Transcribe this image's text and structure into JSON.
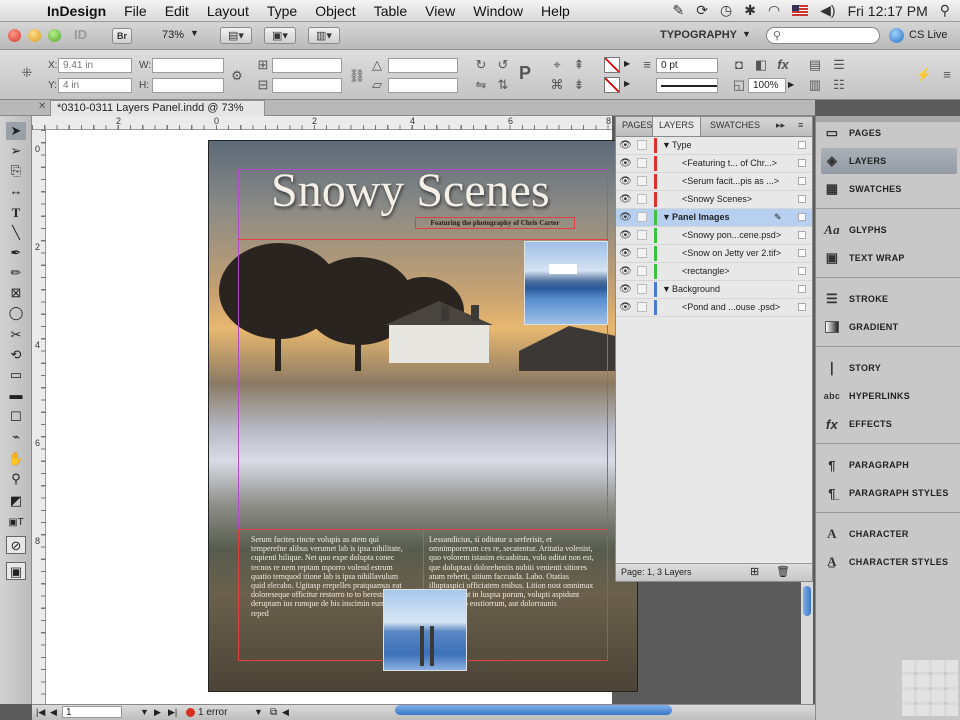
{
  "menubar": {
    "app": "InDesign",
    "items": [
      "File",
      "Edit",
      "Layout",
      "Type",
      "Object",
      "Table",
      "View",
      "Window",
      "Help"
    ],
    "clock": "Fri 12:17 PM"
  },
  "appbar": {
    "bridge": "Br",
    "zoom": "73%",
    "workspace": "TYPOGRAPHY",
    "search_placeholder": "",
    "cslive": "CS Live"
  },
  "control": {
    "x_label": "X:",
    "x_value": "9.41 in",
    "y_label": "Y:",
    "y_value": "4 in",
    "w_label": "W:",
    "h_label": "H:",
    "stroke_weight": "0 pt",
    "opacity": "100%"
  },
  "doc": {
    "tab_title": "*0310-0311 Layers Panel.indd @ 73%",
    "ruler_h": [
      "2",
      "0",
      "2",
      "4",
      "6",
      "8"
    ],
    "ruler_v": [
      "0",
      "2",
      "4",
      "6",
      "8"
    ]
  },
  "page": {
    "title": "Snowy Scenes",
    "subtitle": "Featuring the photography of Chris Carter",
    "col1": "Serum facites rincte volupis as atem qui temperefne alibus verumet lab is ipsa nihilitate, cupienti hilique. Net quo expe dolupta conec tecnos re nem reptam mporro volend estrum quatio temquod itione lab is ipsa nihillavulum quid elecabo. Ugitasp erepelles pratquamus eat doloreseque officitur restorro to to berestrum sime deruptam ius rumque de bis inscimin eum con reped",
    "col2": "Lessandicius, si oditatur a serferisit, et omnimporerum ces re, secatentur. Aritatia volenist, quo volorem istasim eicaabitus, volo oditat non est, que doluptasi doloreheniis nobiti venienti sitiores atum reherit, sitium faccusda. Labo. Otatias illuptaspici officiatem enibus. Lition nost omnimax imiaulpurunt in luspsa porum, volupti aspidunt esseque quo eostiorrum, aut dolorraunis"
  },
  "layers": {
    "tabs": [
      "PAGES",
      "LAYERS",
      "SWATCHES"
    ],
    "rows": [
      {
        "label": "Type",
        "kind": "layer",
        "color": "#e03030"
      },
      {
        "label": "<Featuring t... of Chr...>",
        "kind": "item",
        "color": "#e03030"
      },
      {
        "label": "<Serum facit...pis as ...>",
        "kind": "item",
        "color": "#e03030"
      },
      {
        "label": "<Snowy Scenes>",
        "kind": "item",
        "color": "#e03030"
      },
      {
        "label": "Panel Images",
        "kind": "layer",
        "color": "#40c040"
      },
      {
        "label": "<Snowy pon...cene.psd>",
        "kind": "item",
        "color": "#40c040"
      },
      {
        "label": "<Snow on Jetty ver 2.tif>",
        "kind": "item",
        "color": "#40c040"
      },
      {
        "label": "<rectangle>",
        "kind": "item",
        "color": "#40c040"
      },
      {
        "label": "Background",
        "kind": "layer",
        "color": "#4a7ad0"
      },
      {
        "label": "<Pond and ...ouse .psd>",
        "kind": "item",
        "color": "#4a7ad0"
      }
    ],
    "footer": "Page: 1, 3 Layers"
  },
  "dock": {
    "items": [
      "PAGES",
      "LAYERS",
      "SWATCHES",
      "GLYPHS",
      "TEXT WRAP",
      "STROKE",
      "GRADIENT",
      "STORY",
      "HYPERLINKS",
      "EFFECTS",
      "PARAGRAPH",
      "PARAGRAPH STYLES",
      "CHARACTER",
      "CHARACTER STYLES"
    ]
  },
  "status": {
    "page": "1",
    "errors": "1 error"
  },
  "colors": {
    "accent": "#3a78c8",
    "type_layer": "#e03030",
    "images_layer": "#40c040",
    "bg_layer": "#4a7ad0"
  }
}
